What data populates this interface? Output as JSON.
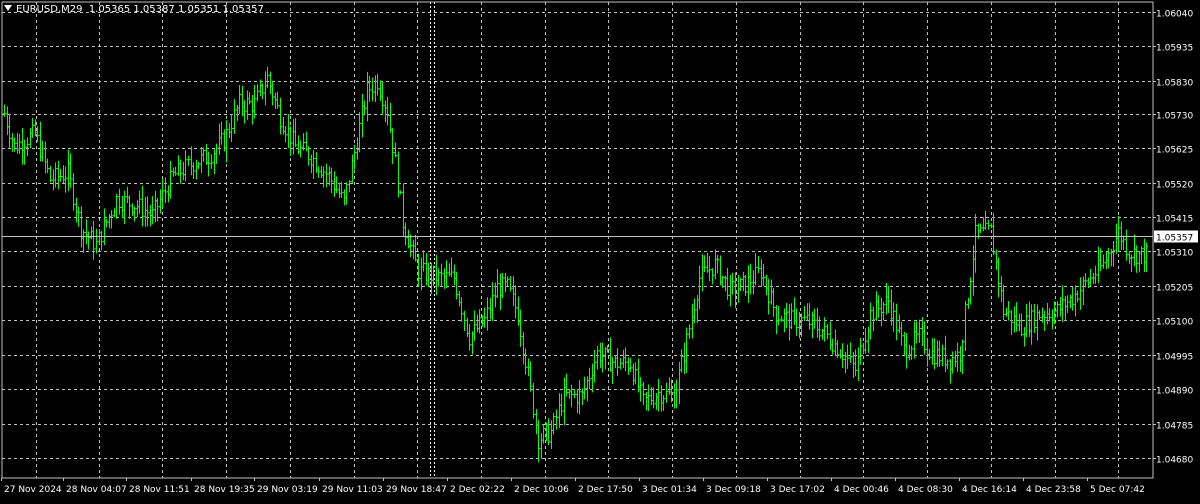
{
  "chart_data": {
    "type": "ohlc",
    "symbol": "EURUSD,M29",
    "header_values": [
      "1.05365",
      "1.05387",
      "1.05351",
      "1.05357"
    ],
    "current_price": 1.05357,
    "current_price_label": "1.05357",
    "ylim": [
      1.0462,
      1.0607
    ],
    "y_ticks": [
      "1.06040",
      "1.05935",
      "1.05830",
      "1.05730",
      "1.05625",
      "1.05520",
      "1.05415",
      "1.05310",
      "1.05205",
      "1.05100",
      "1.04995",
      "1.04890",
      "1.04785",
      "1.04680"
    ],
    "x_labels": [
      "27 Nov 2024",
      "28 Nov 04:07",
      "28 Nov 11:51",
      "28 Nov 19:35",
      "29 Nov 03:19",
      "29 Nov 11:03",
      "29 Nov 18:47",
      "2 Dec 02:22",
      "2 Dec 10:06",
      "2 Dec 17:50",
      "3 Dec 01:34",
      "3 Dec 09:18",
      "3 Dec 17:02",
      "4 Dec 00:46",
      "4 Dec 08:30",
      "4 Dec 16:14",
      "4 Dec 23:58",
      "5 Dec 07:42"
    ],
    "session_breaks": [
      "29 Nov 18:47",
      "2 Dec 02:22"
    ],
    "grid": true,
    "colors": {
      "background": "#000000",
      "bars": "#00ff00",
      "grid": "#c0c0c0",
      "text": "#ffffff",
      "price_line": "#c0c0c0"
    },
    "anchors": [
      [
        0,
        1.0573
      ],
      [
        4,
        1.0563
      ],
      [
        12,
        1.0567
      ],
      [
        18,
        1.0553
      ],
      [
        25,
        1.0555
      ],
      [
        30,
        1.0538
      ],
      [
        36,
        1.0533
      ],
      [
        44,
        1.0547
      ],
      [
        52,
        1.0545
      ],
      [
        58,
        1.0542
      ],
      [
        66,
        1.0554
      ],
      [
        74,
        1.0558
      ],
      [
        80,
        1.056
      ],
      [
        86,
        1.0565
      ],
      [
        92,
        1.0576
      ],
      [
        98,
        1.0576
      ],
      [
        103,
        1.0584
      ],
      [
        108,
        1.0572
      ],
      [
        114,
        1.0563
      ],
      [
        120,
        1.056
      ],
      [
        127,
        1.0554
      ],
      [
        133,
        1.0546
      ],
      [
        138,
        1.0565
      ],
      [
        142,
        1.058
      ],
      [
        146,
        1.0583
      ],
      [
        150,
        1.0574
      ],
      [
        153,
        1.0558
      ],
      [
        156,
        1.054
      ],
      [
        162,
        1.0525
      ],
      [
        170,
        1.0523
      ],
      [
        176,
        1.0523
      ],
      [
        182,
        1.0505
      ],
      [
        188,
        1.051
      ],
      [
        193,
        1.052
      ],
      [
        197,
        1.052
      ],
      [
        201,
        1.0512
      ],
      [
        204,
        1.0498
      ],
      [
        209,
        1.0474
      ],
      [
        214,
        1.0476
      ],
      [
        219,
        1.0487
      ],
      [
        226,
        1.0487
      ],
      [
        232,
        1.05
      ],
      [
        239,
        1.0497
      ],
      [
        245,
        1.0497
      ],
      [
        250,
        1.0485
      ],
      [
        256,
        1.0488
      ],
      [
        262,
        1.0487
      ],
      [
        266,
        1.05
      ],
      [
        272,
        1.0523
      ],
      [
        278,
        1.0527
      ],
      [
        284,
        1.0519
      ],
      [
        290,
        1.0521
      ],
      [
        296,
        1.0525
      ],
      [
        302,
        1.0512
      ],
      [
        308,
        1.051
      ],
      [
        314,
        1.051
      ],
      [
        320,
        1.0507
      ],
      [
        327,
        1.0501
      ],
      [
        333,
        1.0495
      ],
      [
        339,
        1.0512
      ],
      [
        346,
        1.0516
      ],
      [
        352,
        1.0501
      ],
      [
        358,
        1.0505
      ],
      [
        363,
        1.05
      ],
      [
        370,
        1.0498
      ],
      [
        374,
        1.05
      ],
      [
        380,
        1.0536
      ],
      [
        386,
        1.0537
      ],
      [
        391,
        1.0513
      ],
      [
        398,
        1.0508
      ],
      [
        405,
        1.0512
      ],
      [
        412,
        1.0513
      ],
      [
        418,
        1.0517
      ],
      [
        424,
        1.0522
      ],
      [
        430,
        1.0527
      ],
      [
        436,
        1.0537
      ],
      [
        440,
        1.0531
      ],
      [
        444,
        1.053
      ],
      [
        447,
        1.053
      ]
    ]
  }
}
